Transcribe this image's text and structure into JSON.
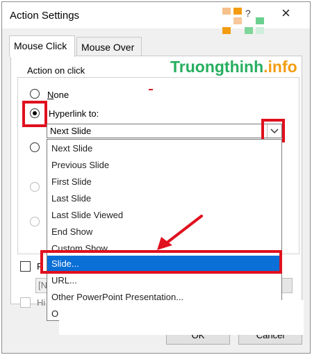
{
  "dialog": {
    "title": "Action Settings",
    "help": "?",
    "close": "×"
  },
  "tabs": [
    {
      "label": "Mouse Click",
      "active": true
    },
    {
      "label": "Mouse Over",
      "active": false
    }
  ],
  "group": {
    "title": "Action on click",
    "options": {
      "none": "None",
      "hyperlink": "Hyperlink to:"
    },
    "hyperlink_selected": "Next Slide"
  },
  "dropdown_items": [
    "Next Slide",
    "Previous Slide",
    "First Slide",
    "Last Slide",
    "Last Slide Viewed",
    "End Show",
    "Custom Show...",
    "Slide...",
    "URL...",
    "Other PowerPoint Presentation...",
    "O"
  ],
  "selected_item": "Slide...",
  "partial_labels": {
    "p": "P",
    "n": "[N",
    "hi": "Hi"
  },
  "buttons": {
    "ok": "OK",
    "cancel": "Cancel"
  },
  "watermark": {
    "part1": "Truongthinh",
    "part2": ".info"
  },
  "colors": {
    "highlight_red": "#e0101e",
    "selection_blue": "#0a6fd6",
    "logo_green": "#27ae60",
    "logo_orange": "#f39c12"
  }
}
